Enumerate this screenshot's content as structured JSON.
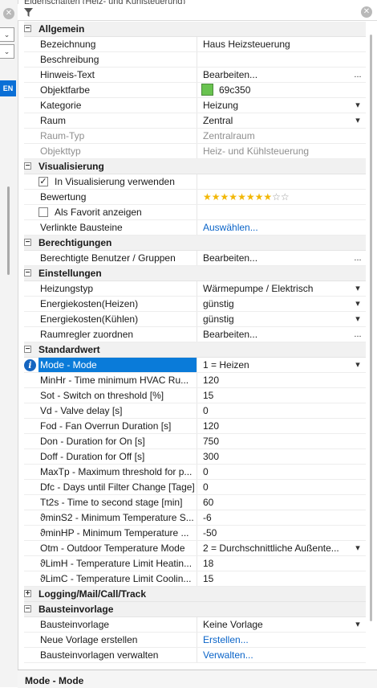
{
  "window": {
    "title_partial": "Eigenschaften (Heiz- und Kühlsteuerung)"
  },
  "left_panel": {
    "button_label": "EN"
  },
  "sections": [
    {
      "title": "Allgemein",
      "expanded": true,
      "rows": [
        {
          "label": "Bezeichnung",
          "value": "Haus Heizsteuerung",
          "kind": "text"
        },
        {
          "label": "Beschreibung",
          "value": "",
          "kind": "text"
        },
        {
          "label": "Hinweis-Text",
          "value": "Bearbeiten...",
          "kind": "ellipsis"
        },
        {
          "label": "Objektfarbe",
          "value": "69c350",
          "kind": "color",
          "color": "#69c350"
        },
        {
          "label": "Kategorie",
          "value": "Heizung",
          "kind": "dropdown"
        },
        {
          "label": "Raum",
          "value": "Zentral",
          "kind": "dropdown"
        },
        {
          "label": "Raum-Typ",
          "value": "Zentralraum",
          "kind": "readonly"
        },
        {
          "label": "Objekttyp",
          "value": "Heiz- und Kühlsteuerung",
          "kind": "readonly"
        }
      ]
    },
    {
      "title": "Visualisierung",
      "expanded": true,
      "rows": [
        {
          "label": "In Visualisierung verwenden",
          "value": "",
          "kind": "checkbox",
          "checked": true
        },
        {
          "label": "Bewertung",
          "value": "",
          "kind": "rating",
          "rating": 8,
          "max": 10
        },
        {
          "label": "Als Favorit anzeigen",
          "value": "",
          "kind": "checkbox",
          "checked": false
        },
        {
          "label": "Verlinkte Bausteine",
          "value": "Auswählen...",
          "kind": "link"
        }
      ]
    },
    {
      "title": "Berechtigungen",
      "expanded": true,
      "rows": [
        {
          "label": "Berechtigte Benutzer / Gruppen",
          "value": "Bearbeiten...",
          "kind": "ellipsis"
        }
      ]
    },
    {
      "title": "Einstellungen",
      "expanded": true,
      "rows": [
        {
          "label": "Heizungstyp",
          "value": "Wärmepumpe / Elektrisch",
          "kind": "dropdown"
        },
        {
          "label": "Energiekosten(Heizen)",
          "value": "günstig",
          "kind": "dropdown"
        },
        {
          "label": "Energiekosten(Kühlen)",
          "value": "günstig",
          "kind": "dropdown"
        },
        {
          "label": "Raumregler zuordnen",
          "value": "Bearbeiten...",
          "kind": "ellipsis"
        }
      ]
    },
    {
      "title": "Standardwert",
      "expanded": true,
      "rows": [
        {
          "label": "Mode - Mode",
          "value": "1 = Heizen",
          "kind": "dropdown",
          "selected": true,
          "info": true
        },
        {
          "label": "MinHr - Time minimum HVAC Ru...",
          "value": "120",
          "kind": "text"
        },
        {
          "label": "Sot - Switch on threshold [%]",
          "value": "15",
          "kind": "text"
        },
        {
          "label": "Vd - Valve delay [s]",
          "value": "0",
          "kind": "text"
        },
        {
          "label": "Fod - Fan Overrun Duration [s]",
          "value": "120",
          "kind": "text"
        },
        {
          "label": "Don - Duration for On [s]",
          "value": "750",
          "kind": "text"
        },
        {
          "label": "Doff - Duration for Off [s]",
          "value": "300",
          "kind": "text"
        },
        {
          "label": "MaxTp - Maximum threshold for p...",
          "value": "0",
          "kind": "text"
        },
        {
          "label": "Dfc - Days until Filter Change [Tage]",
          "value": "0",
          "kind": "text"
        },
        {
          "label": "Tt2s - Time to second stage [min]",
          "value": "60",
          "kind": "text"
        },
        {
          "label": "ϑminS2 - Minimum Temperature S...",
          "value": "-6",
          "kind": "text"
        },
        {
          "label": "ϑminHP - Minimum Temperature ...",
          "value": "-50",
          "kind": "text"
        },
        {
          "label": "Otm - Outdoor Temperature Mode",
          "value": "2 = Durchschnittliche Außente...",
          "kind": "dropdown"
        },
        {
          "label": "ϑLimH - Temperature Limit Heatin...",
          "value": "18",
          "kind": "text"
        },
        {
          "label": "ϑLimC - Temperature Limit Coolin...",
          "value": "15",
          "kind": "text"
        }
      ]
    },
    {
      "title": "Logging/Mail/Call/Track",
      "expanded": false,
      "rows": []
    },
    {
      "title": "Bausteinvorlage",
      "expanded": true,
      "rows": [
        {
          "label": "Bausteinvorlage",
          "value": "Keine Vorlage",
          "kind": "dropdown"
        },
        {
          "label": "Neue Vorlage erstellen",
          "value": "Erstellen...",
          "kind": "link"
        },
        {
          "label": "Bausteinvorlagen verwalten",
          "value": "Verwalten...",
          "kind": "link"
        }
      ]
    }
  ],
  "description": {
    "title": "Mode - Mode"
  },
  "icons": {
    "filter": "filter-icon",
    "close": "close-icon",
    "info": "info-icon",
    "dropdown": "dropdown-arrow-icon"
  }
}
